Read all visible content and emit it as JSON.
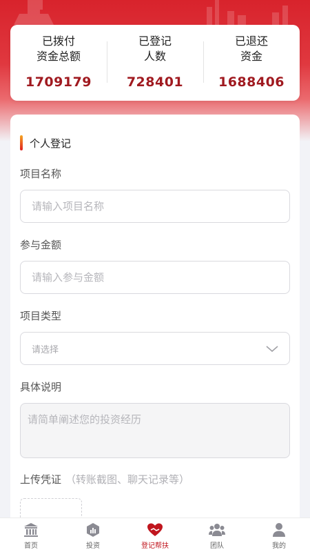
{
  "stats": [
    {
      "label_line1": "已拨付",
      "label_line2": "资金总额",
      "value": "1709179"
    },
    {
      "label_line1": "已登记",
      "label_line2": "人数",
      "value": "728401"
    },
    {
      "label_line1": "已退还",
      "label_line2": "资金",
      "value": "1688406"
    }
  ],
  "form": {
    "section_title": "个人登记",
    "project_name": {
      "label": "项目名称",
      "placeholder": "请输入项目名称",
      "value": ""
    },
    "amount": {
      "label": "参与金额",
      "placeholder": "请输入参与金额",
      "value": ""
    },
    "project_type": {
      "label": "项目类型",
      "selected": "请选择"
    },
    "description": {
      "label": "具体说明",
      "placeholder": "请简单阐述您的投资经历",
      "value": ""
    },
    "upload": {
      "label": "上传凭证",
      "hint": "（转账截图、聊天记录等）"
    }
  },
  "tabbar": {
    "items": [
      {
        "label": "首页",
        "icon": "bank-icon"
      },
      {
        "label": "投资",
        "icon": "invest-icon"
      },
      {
        "label": "登记帮扶",
        "icon": "heart-hand-icon"
      },
      {
        "label": "团队",
        "icon": "team-icon"
      },
      {
        "label": "我的",
        "icon": "user-icon"
      }
    ],
    "active_index": 2
  },
  "colors": {
    "brand_red": "#d8232c",
    "value_red": "#a01a20",
    "active_tab": "#c0161e"
  }
}
